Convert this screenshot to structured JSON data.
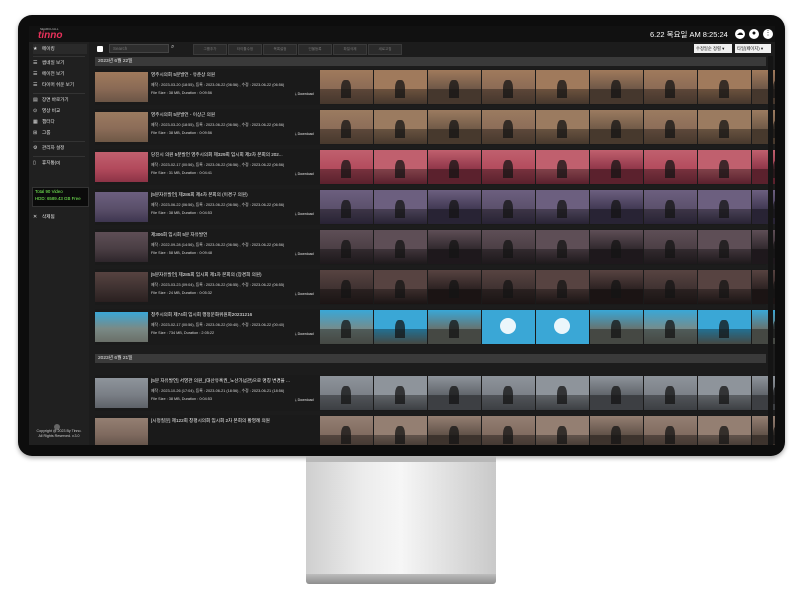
{
  "header": {
    "logo_text": "tinno",
    "logo_subtext": "SEARCH ALL",
    "clock": "6.22 목요일 AM 8:25:24"
  },
  "sidebar": {
    "items": [
      {
        "label": "메이킹",
        "icon": "star-icon"
      },
      {
        "label": "썸네일 보기",
        "icon": "list-icon"
      },
      {
        "label": "에이전 보기",
        "icon": "list-icon"
      },
      {
        "label": "타이머 쉬운 보기",
        "icon": "list-icon"
      },
      {
        "label": "장면 바로가기",
        "icon": "scene-icon"
      },
      {
        "label": "영상 비교",
        "icon": "compare-icon"
      },
      {
        "label": "챕터다",
        "icon": "chapter-icon"
      },
      {
        "label": "그룹",
        "icon": "group-icon"
      },
      {
        "label": "관리자 설정",
        "icon": "gear-icon"
      },
      {
        "label": "휴지통(0)",
        "icon": "trash-icon"
      },
      {
        "label": "삭제됨",
        "icon": "close-icon"
      }
    ],
    "storage_line1": "Total 90 Video",
    "storage_line2": "HDD: 6589.43 GB Free",
    "copyright_line1": "Copyright @ 2023 By Tinno.",
    "copyright_line2": "All Rights Reserved. v.3.0"
  },
  "toolbar": {
    "search_placeholder": "Search",
    "buttons": [
      "그룹추가",
      "타이틀수정",
      "목록설정",
      "인물등록",
      "파일삭제",
      "새로고침"
    ],
    "sort_value": "수정일순 정렬",
    "page_size_value": "타일(페이지)"
  },
  "groups": [
    {
      "date": "2023년 6월 22일",
      "rows": [
        {
          "title": "영주시의회 5분발언 - 유춘상 의원",
          "meta": "제작 : 2023-03-20 (18:55), 등록 : 2023-06-22 (06:56) , 수정 : 2023-06-22 (06:56)",
          "size": "File Size : 38 MB, Duration : 0:09:56"
        },
        {
          "title": "영주시의회 5분발언 - 이상근 의원",
          "meta": "제작 : 2023-03-20 (18:55), 등록 : 2023-06-22 (06:56) , 수정 : 2023-06-22 (06:56)",
          "size": "File Size : 38 MB, Duration : 0:09:56"
        },
        {
          "title": "당진시 의원 5분발언 영주시의회 제329회 임시회 제2차 본회의 202...",
          "meta": "제작 : 2023-02-17 (00:56), 등록 : 2023-06-22 (06:56) , 수정 : 2023-06-22 (06:56)",
          "size": "File Size : 31 MB, Duration : 0:04:41"
        },
        {
          "title": "[5분자유발언] 제286회 제4차 본회의 (이경구 의원)",
          "meta": "제작 : 2023-06-22 (06:56), 등록 : 2023-06-22 (06:56) , 수정 : 2023-06-22 (06:56)",
          "size": "File Size : 38 MB, Duration : 0:04:53"
        },
        {
          "title": "제306회 임시회 5분 자유발언",
          "meta": "제작 : 2022-09-28 (14:56), 등록 : 2023-06-22 (06:56) , 수정 : 2023-06-22 (06:56)",
          "size": "File Size : 58 MB, Duration : 0:09:48"
        },
        {
          "title": "[5분자유발언] 제285회 임시회 제1차 본회의 (장경희 의원)",
          "meta": "제작 : 2023-03-23 (09:04), 등록 : 2023-06-22 (06:55) , 수정 : 2023-06-22 (06:55)",
          "size": "File Size : 24 MB, Duration : 0:05:32"
        },
        {
          "title": "청주시의회 제74회 임시회 행정문화위원회20231216",
          "meta": "제작 : 2023-02-17 (00:56), 등록 : 2023-06-22 (00:40) , 수정 : 2023-06-22 (00:40)",
          "size": "File Size : 734 MB, Duration : 2:05:22"
        }
      ]
    },
    {
      "date": "2023년 6월 21일",
      "rows": [
        {
          "title": "[5분 자유발언] 서영관 의원_(대산유혹권_노산가넘관)으로 명칭 변경을 ...",
          "meta": "제작 : 2023-10-26 (17:04), 등록 : 2023-06-21 (18:56) , 수정 : 2023-06-21 (18:56)",
          "size": "File Size : 38 MB, Duration : 0:04:53"
        },
        {
          "title": "[시정질문] 제122회 창평시의회 임시회 2차 본회의 황영례 의원",
          "meta": "",
          "size": ""
        }
      ]
    }
  ],
  "download_label": "⤓ Download",
  "row_palettes": [
    [
      "#8a6a55",
      "#a07a5c",
      "#6b5546"
    ],
    [
      "#8b6c58",
      "#9b7b60",
      "#6e5846"
    ],
    [
      "#b24a5c",
      "#c0606e",
      "#8c3346"
    ],
    [
      "#5a4f6a",
      "#6c5f7f",
      "#3e3650"
    ],
    [
      "#4a3e44",
      "#5e4e56",
      "#2e262b"
    ],
    [
      "#3e3130",
      "#574341",
      "#2a2020"
    ],
    [
      "#7a8a86",
      "#3aa7d6",
      "#6a6f68"
    ],
    [
      "#7a7f86",
      "#8e949b",
      "#5e6268"
    ],
    [
      "#7f6a5f",
      "#947f72",
      "#5e4f46"
    ]
  ],
  "colors": {
    "accent": "#e8315a",
    "storage_text": "#7dff5a"
  }
}
